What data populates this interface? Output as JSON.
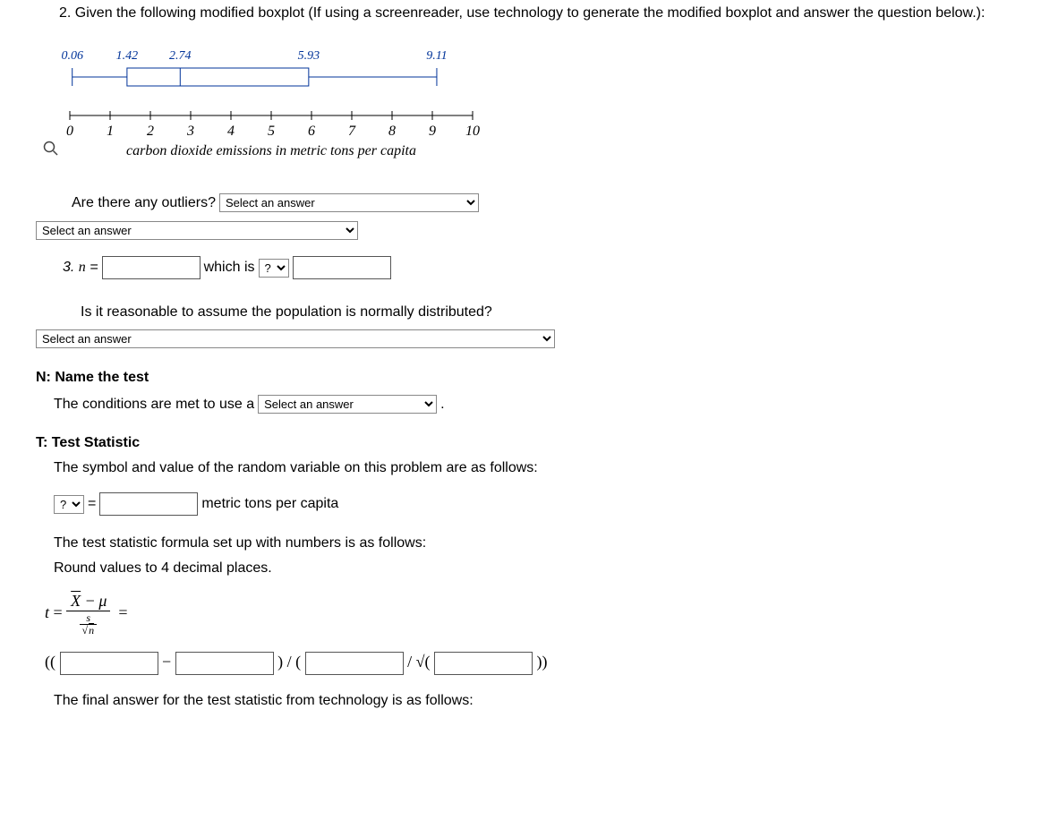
{
  "q2": {
    "prompt": "2. Given the following modified boxplot (If using a screenreader, use technology to generate the modified boxplot and answer the question below.):"
  },
  "chart_data": {
    "type": "boxplot",
    "min": 0.06,
    "q1": 1.42,
    "median": 2.74,
    "q3": 5.93,
    "max": 9.11,
    "value_labels": [
      "0.06",
      "1.42",
      "2.74",
      "5.93",
      "9.11"
    ],
    "ticks": [
      "0",
      "1",
      "2",
      "3",
      "4",
      "5",
      "6",
      "7",
      "8",
      "9",
      "10"
    ],
    "xlabel": "carbon dioxide emissions in metric tons per capita",
    "xlim": [
      0,
      10
    ]
  },
  "outliers": {
    "question": "Are there any outliers?",
    "placeholder1": "Select an answer",
    "placeholder2": "Select an answer"
  },
  "q3": {
    "label_n": "3. n =",
    "which_is": "which is",
    "which_placeholder": "?"
  },
  "normal": {
    "question": "Is it reasonable to assume the population is normally distributed?",
    "placeholder": "Select an answer"
  },
  "nameTest": {
    "heading": "N: Name the test",
    "line": "The conditions are met to use a",
    "placeholder": "Select an answer",
    "period": "."
  },
  "tstat": {
    "heading": "T: Test Statistic",
    "line1": "The symbol and value of the random variable on this problem are as follows:",
    "symbol_placeholder": "?",
    "equals": "=",
    "units": "metric tons per capita",
    "line2": "The test statistic formula set up with numbers is as follows:",
    "line3": "Round values to 4 decimal places.",
    "formula_lhs": "t =",
    "formula_num_xbar": "X",
    "formula_num_minus": "−",
    "formula_num_mu": "μ",
    "formula_den_s": "s",
    "formula_den_sqrtn": "√",
    "formula_den_n": "n",
    "formula_rhs_eq": "=",
    "calc_open": "((",
    "calc_minus": "−",
    "calc_close1": ") / (",
    "calc_sqrt": " / √(",
    "calc_close2": "))",
    "final_line": "The final answer for the test statistic from technology is as follows:"
  }
}
